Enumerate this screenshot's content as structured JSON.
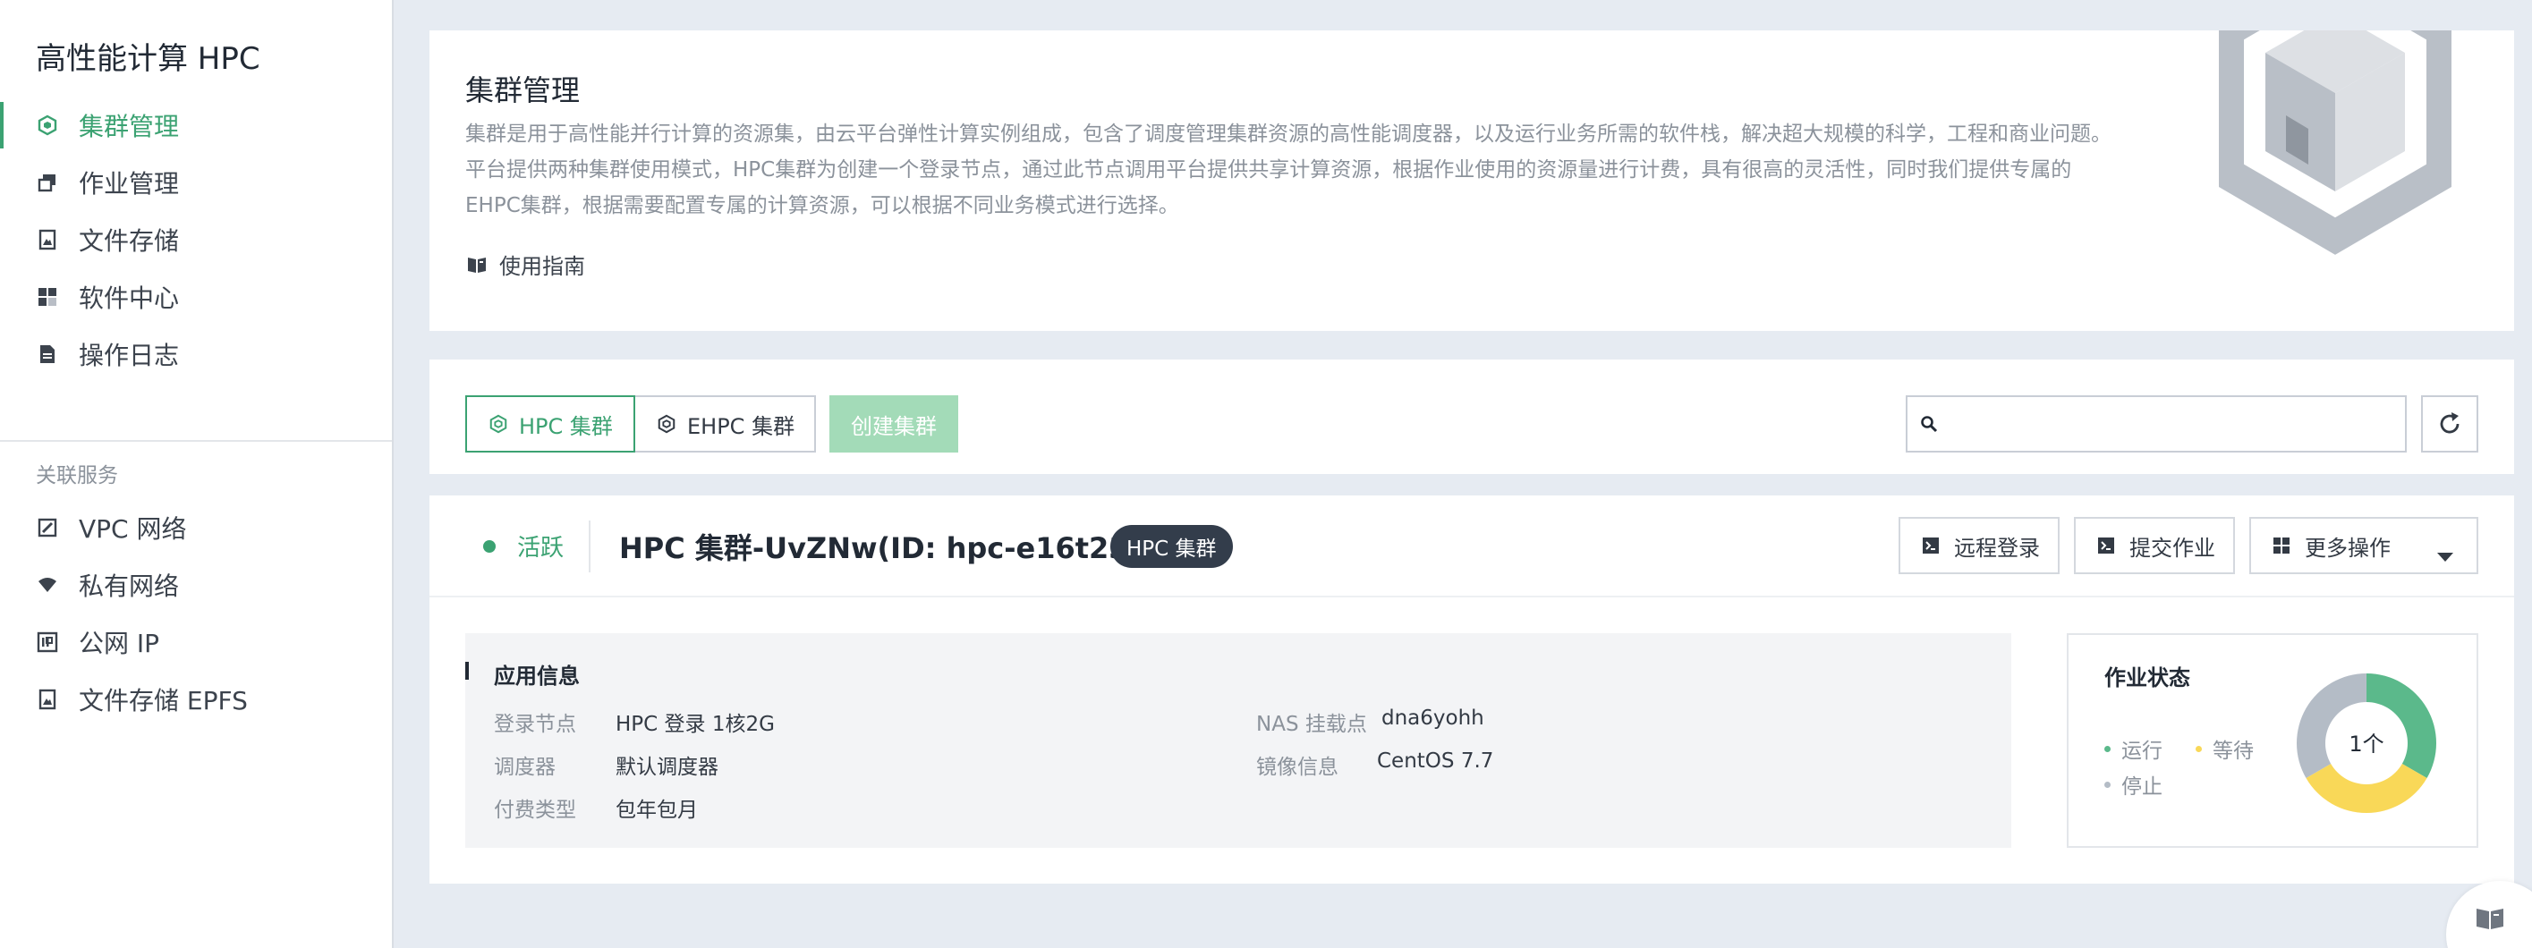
{
  "app": {
    "title": "高性能计算 HPC"
  },
  "sidebar": {
    "items": [
      {
        "label": "集群管理",
        "icon": "cluster-icon",
        "active": true
      },
      {
        "label": "作业管理",
        "icon": "jobs-icon"
      },
      {
        "label": "文件存储",
        "icon": "file-storage-icon"
      },
      {
        "label": "软件中心",
        "icon": "software-grid-icon"
      },
      {
        "label": "操作日志",
        "icon": "log-document-icon"
      }
    ],
    "related_label": "关联服务",
    "related_items": [
      {
        "label": "VPC 网络",
        "icon": "vpc-icon"
      },
      {
        "label": "私有网络",
        "icon": "wifi-icon"
      },
      {
        "label": "公网 IP",
        "icon": "ip-icon"
      },
      {
        "label": "文件存储 EPFS",
        "icon": "file-storage-icon"
      }
    ]
  },
  "intro": {
    "title": "集群管理",
    "lines": [
      "集群是用于高性能并行计算的资源集，由云平台弹性计算实例组成，包含了调度管理集群资源的高性能调度器，以及运行业务所需的软件栈，解决超大规模的科学，工程和商业问题。",
      "平台提供两种集群使用模式，HPC集群为创建一个登录节点，通过此节点调用平台提供共享计算资源，根据作业使用的资源量进行计费，具有很高的灵活性，同时我们提供专属的",
      "EHPC集群，根据需要配置专属的计算资源，可以根据不同业务模式进行选择。"
    ],
    "guide_label": "使用指南"
  },
  "toolbar": {
    "tabs": [
      {
        "label": "HPC 集群",
        "active": true
      },
      {
        "label": "EHPC 集群"
      }
    ],
    "create_label": "创建集群",
    "search_placeholder": ""
  },
  "cluster": {
    "status": "活跃",
    "name": "HPC 集群-UvZNw(ID: hpc-e16t23bh)",
    "badge": "HPC 集群",
    "actions": {
      "remote_login": "远程登录",
      "submit_job": "提交作业",
      "more": "更多操作"
    },
    "info": {
      "title": "应用信息",
      "login_node_label": "登录节点",
      "login_node": "HPC 登录 1核2G",
      "scheduler_label": "调度器",
      "scheduler": "默认调度器",
      "billing_label": "付费类型",
      "billing": "包年包月",
      "nas_label": "NAS 挂载点",
      "nas": "dna6yohh",
      "image_label": "镜像信息",
      "image": "CentOS 7.7"
    },
    "job_status": {
      "title": "作业状态",
      "legend": {
        "running": "运行",
        "waiting": "等待",
        "stopped": "停止"
      },
      "center": "1个",
      "fractions": {
        "running": 0.3333,
        "waiting": 0.3333,
        "stopped": 0.3333
      },
      "colors": {
        "running": "#5bb98b",
        "waiting": "#f9d858",
        "stopped": "#b4bcc6"
      }
    }
  },
  "colors": {
    "accent": "#3ba272",
    "badge": "#333d4b",
    "create_disabled": "#a3dbb8"
  }
}
